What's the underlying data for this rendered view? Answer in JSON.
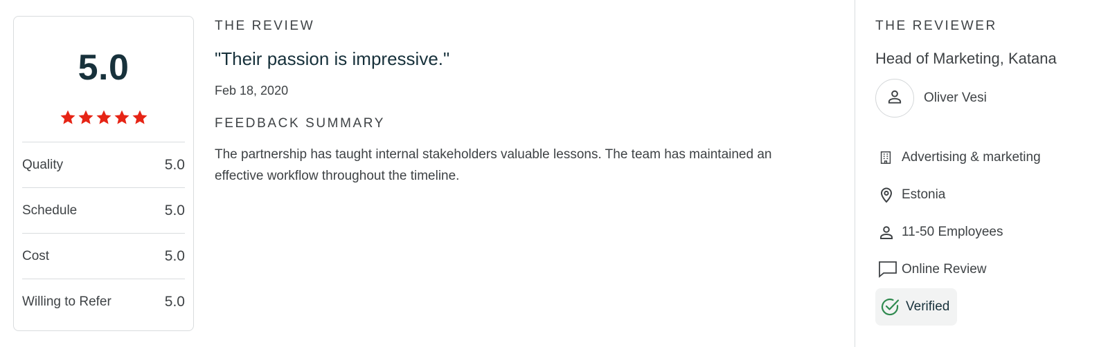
{
  "scores": {
    "overall": "5.0",
    "stars": 5,
    "star_color": "#e62415",
    "rows": [
      {
        "label": "Quality",
        "value": "5.0"
      },
      {
        "label": "Schedule",
        "value": "5.0"
      },
      {
        "label": "Cost",
        "value": "5.0"
      },
      {
        "label": "Willing to Refer",
        "value": "5.0"
      }
    ]
  },
  "review": {
    "heading": "THE REVIEW",
    "title": "\"Their passion is impressive.\"",
    "date": "Feb 18, 2020",
    "feedback_heading": "FEEDBACK SUMMARY",
    "feedback_text": "The partnership has taught internal stakeholders valuable lessons. The team has maintained an effective workflow throughout the timeline."
  },
  "reviewer": {
    "heading": "THE REVIEWER",
    "role": "Head of Marketing, Katana",
    "name": "Oliver Vesi",
    "avatar_icon": "user-icon",
    "details": [
      {
        "icon": "building-icon",
        "text": "Advertising & marketing"
      },
      {
        "icon": "location-pin-icon",
        "text": "Estonia"
      },
      {
        "icon": "user-icon",
        "text": "11-50 Employees"
      },
      {
        "icon": "chat-bubble-icon",
        "text": "Online Review"
      }
    ],
    "verified": {
      "icon": "check-circle-icon",
      "text": "Verified",
      "color": "#2f8a4f"
    }
  }
}
